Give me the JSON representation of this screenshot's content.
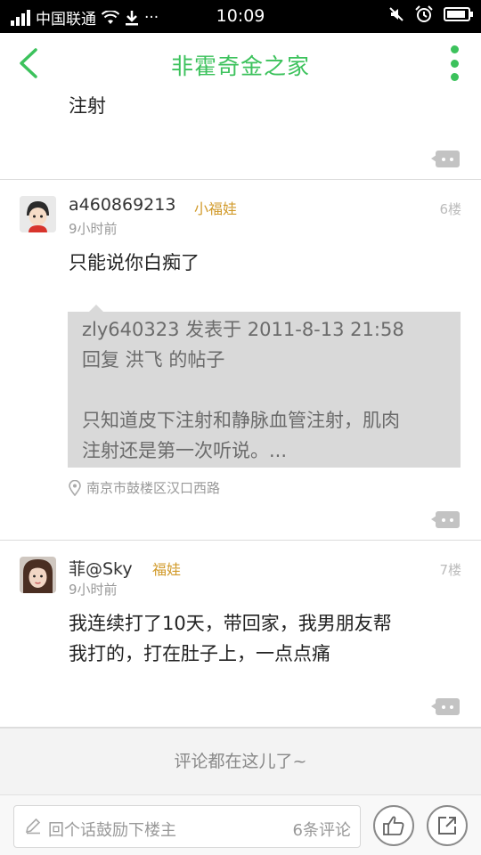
{
  "status_bar": {
    "carrier": "中国联通",
    "time": "10:09",
    "more": "···"
  },
  "nav": {
    "title": "非霍奇金之家",
    "accent_color": "#3cc25c",
    "back_icon": "chevron-left-icon",
    "more_icon": "vertical-dots-icon"
  },
  "posts": [
    {
      "body": "注射"
    },
    {
      "username": "a460869213",
      "badge": "小福娃",
      "time": "9小时前",
      "floor": "6楼",
      "body": "只能说你白痴了",
      "quote": {
        "line1": "zly640323 发表于 2011-8-13 21:58",
        "line2": "回复 洪飞 的帖子",
        "line3": "只知道皮下注射和静脉血管注射，肌肉",
        "line4": "注射还是第一次听说。..."
      },
      "location": "南京市鼓楼区汉口西路"
    },
    {
      "username": "菲@Sky",
      "badge": "福娃",
      "time": "9小时前",
      "floor": "7楼",
      "body_line1": "我连续打了10天，带回家，我男朋友帮",
      "body_line2": "我打的，打在肚子上，一点点痛"
    }
  ],
  "more_comments": "评论都在这儿了~",
  "bottom_bar": {
    "reply_placeholder": "回个话鼓励下楼主",
    "comment_count": "6条评论",
    "like_icon": "thumbs-up-icon",
    "share_icon": "share-icon"
  }
}
